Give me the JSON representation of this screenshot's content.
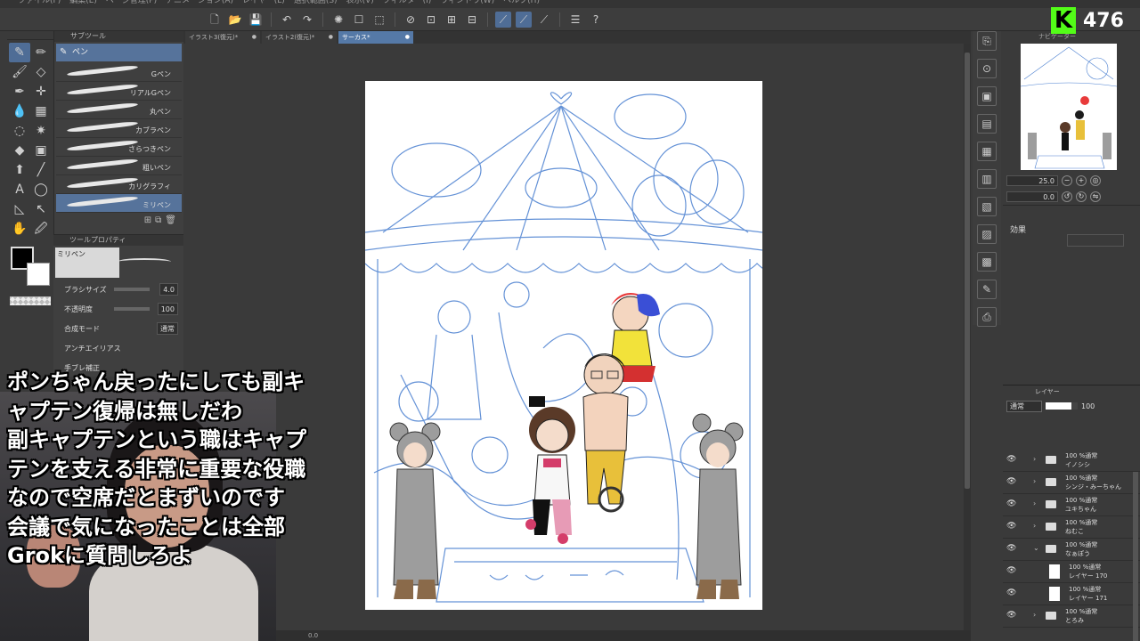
{
  "menubar": [
    "ファイル(F)",
    "編集(E)",
    "ページ管理(P)",
    "アニメーション(A)",
    "レイヤー(L)",
    "選択範囲(S)",
    "表示(V)",
    "フィルター(I)",
    "ウィンドウ(W)",
    "ヘルプ(H)"
  ],
  "tabs": [
    {
      "label": "イラスト3(復元)*"
    },
    {
      "label": "イラスト2(復元)*"
    },
    {
      "label": "サーカス*"
    }
  ],
  "subtool": {
    "header": "サブツール",
    "group": "ペン",
    "brushes": [
      "Gペン",
      "リアルGペン",
      "丸ペン",
      "カブラペン",
      "さらつきペン",
      "粗いペン",
      "カリグラフィ",
      "ミリペン"
    ],
    "selected": "ミリペン"
  },
  "toolprop": {
    "header": "ツールプロパティ",
    "preview_label": "ミリペン",
    "brush_size_label": "ブラシサイズ",
    "brush_size": "4.0",
    "opacity_label": "不透明度",
    "opacity": "100",
    "blend_label": "合成モード",
    "blend": "通常",
    "antialias_label": "アンチエイリアス",
    "stabilize_label": "手ブレ補正"
  },
  "navigator": {
    "header": "ナビゲーター",
    "zoom": "25.0",
    "rotation": "0.0"
  },
  "effect": {
    "label": "効果"
  },
  "layer_panel": {
    "header": "レイヤー",
    "blend": "通常",
    "opacity": "100",
    "layers": [
      {
        "percent": "100 %通常",
        "name": "イノシシ",
        "type": "folder"
      },
      {
        "percent": "100 %通常",
        "name": "シンジ・みーちゃん",
        "type": "folder"
      },
      {
        "percent": "100 %通常",
        "name": "ユキちゃん",
        "type": "folder"
      },
      {
        "percent": "100 %通常",
        "name": "ねむこ",
        "type": "folder"
      },
      {
        "percent": "100 %通常",
        "name": "なぁぽう",
        "type": "folder-open"
      },
      {
        "percent": "100 %通常",
        "name": "レイヤー 170",
        "type": "layer"
      },
      {
        "percent": "100 %通常",
        "name": "レイヤー 171",
        "type": "layer"
      },
      {
        "percent": "100 %通常",
        "name": "とろみ",
        "type": "folder"
      }
    ]
  },
  "counter": {
    "logo": "K",
    "value": "476"
  },
  "subtitles": [
    "ポンちゃん戻ったにしても副キ",
    "ャプテン復帰は無しだわ",
    "副キャプテンという職はキャプ",
    "テンを支える非常に重要な役職",
    "なので空席だとまずいのです",
    "会議で気になったことは全部",
    "Grokに質問しろよ"
  ],
  "statusbar": {
    "zoom": "0.0"
  },
  "colors": {
    "accent": "#5579a7",
    "sketch": "#4a7fd0",
    "kick_green": "#53fc18"
  }
}
